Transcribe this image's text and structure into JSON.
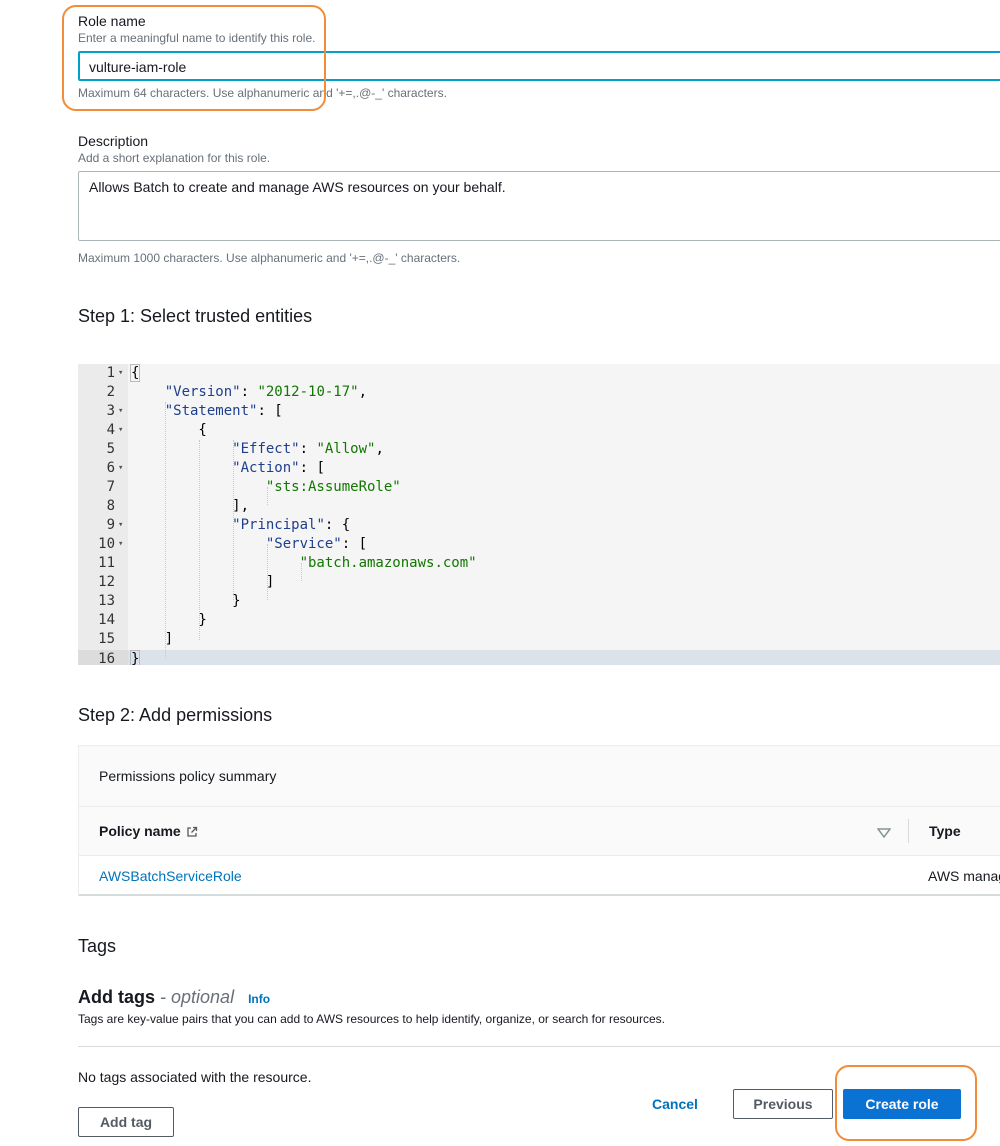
{
  "role_name": {
    "label": "Role name",
    "hint": "Enter a meaningful name to identify this role.",
    "value": "vulture-iam-role",
    "constraint": "Maximum 64 characters. Use alphanumeric and '+=,.@-_' characters."
  },
  "description": {
    "label": "Description",
    "hint": "Add a short explanation for this role.",
    "value": "Allows Batch to create and manage AWS resources on your behalf.",
    "constraint": "Maximum 1000 characters. Use alphanumeric and '+=,.@-_' characters."
  },
  "step1": {
    "title": "Step 1: Select trusted entities",
    "line_numbers": [
      "1",
      "2",
      "3",
      "4",
      "5",
      "6",
      "7",
      "8",
      "9",
      "10",
      "11",
      "12",
      "13",
      "14",
      "15",
      "16"
    ],
    "code": {
      "open_brace": "{",
      "version_key": "\"Version\"",
      "version_val": "\"2012-10-17\"",
      "statement_key": "\"Statement\"",
      "effect_key": "\"Effect\"",
      "effect_val": "\"Allow\"",
      "action_key": "\"Action\"",
      "action_val": "\"sts:AssumeRole\"",
      "principal_key": "\"Principal\"",
      "service_key": "\"Service\"",
      "service_val": "\"batch.amazonaws.com\"",
      "close_brace": "}"
    }
  },
  "step2": {
    "title": "Step 2: Add permissions",
    "summary_title": "Permissions policy summary",
    "col_policy_name": "Policy name",
    "col_type": "Type",
    "rows": [
      {
        "policy_name": "AWSBatchServiceRole",
        "type": "AWS manag"
      }
    ]
  },
  "tags": {
    "title": "Tags",
    "add_tags_title": "Add tags",
    "optional": "- optional",
    "info": "Info",
    "description": "Tags are key-value pairs that you can add to AWS resources to help identify, organize, or search for resources.",
    "empty": "No tags associated with the resource.",
    "add_tag_button": "Add tag"
  },
  "footer": {
    "cancel": "Cancel",
    "previous": "Previous",
    "create_role": "Create role"
  },
  "colors": {
    "highlight": "#f28c38",
    "primary": "#0972d3",
    "link": "#0073bb"
  }
}
